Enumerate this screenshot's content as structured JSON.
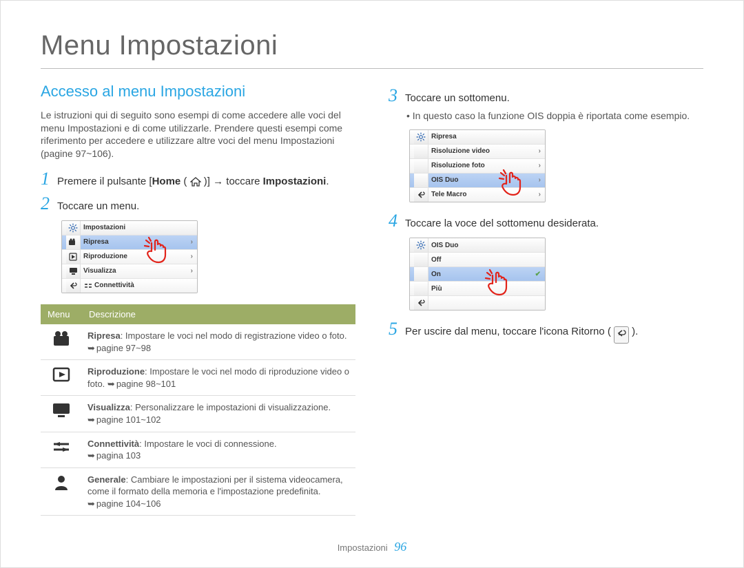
{
  "page": {
    "title": "Menu Impostazioni",
    "footer_label": "Impostazioni",
    "footer_page": "96"
  },
  "left": {
    "section_title": "Accesso al menu Impostazioni",
    "intro": "Le istruzioni qui di seguito sono esempi di come accedere alle voci del menu Impostazioni e di come utilizzarle. Prendere questi esempi come riferimento per accedere e utilizzare altre voci del menu Impostazioni (pagine 97~106).",
    "step1_num": "1",
    "step1_pre": "Premere il pulsante [",
    "step1_home": "Home",
    "step1_mid": " ( ",
    "step1_post": " )] → toccare ",
    "step1_impost": "Impostazioni",
    "step1_end": ".",
    "step2_num": "2",
    "step2_text": "Toccare un menu.",
    "lcd1": {
      "header": "Impostazioni",
      "rows": [
        "Ripresa",
        "Riproduzione",
        "Visualizza",
        "Connettività"
      ]
    },
    "table": {
      "col1": "Menu",
      "col2": "Descrizione",
      "rows": [
        {
          "icon": "camera",
          "name": "Ripresa",
          "desc": ": Impostare le voci nel modo di registrazione video o foto.",
          "ref": "pagine 97~98"
        },
        {
          "icon": "play",
          "name": "Riproduzione",
          "desc": ": Impostare le voci nel modo di riproduzione video o foto.",
          "ref": "pagine 98~101"
        },
        {
          "icon": "display",
          "name": "Visualizza",
          "desc": ": Personalizzare le impostazioni di visualizzazione.",
          "ref": "pagine 101~102"
        },
        {
          "icon": "conn",
          "name": "Connettività",
          "desc": ": Impostare le voci di connessione.",
          "ref": "pagina 103"
        },
        {
          "icon": "person",
          "name": "Generale",
          "desc": ": Cambiare le impostazioni per il sistema videocamera, come il formato della memoria e l'impostazione predefinita.",
          "ref": "pagine 104~106"
        }
      ]
    }
  },
  "right": {
    "step3_num": "3",
    "step3_text": "Toccare un sottomenu.",
    "step3_bullet": "In questo caso la funzione OIS doppia è riportata come esempio.",
    "lcd2": {
      "header": "Ripresa",
      "rows": [
        "Risoluzione video",
        "Risoluzione foto",
        "OIS Duo",
        "Tele Macro"
      ],
      "selected_index": 2
    },
    "step4_num": "4",
    "step4_text": "Toccare la voce del sottomenu desiderata.",
    "lcd3": {
      "header": "OIS Duo",
      "rows": [
        "Off",
        "On",
        "Più"
      ],
      "selected_index": 1
    },
    "step5_num": "5",
    "step5_text_pre": "Per uscire dal menu, toccare l'icona Ritorno ( ",
    "step5_text_post": " )."
  }
}
